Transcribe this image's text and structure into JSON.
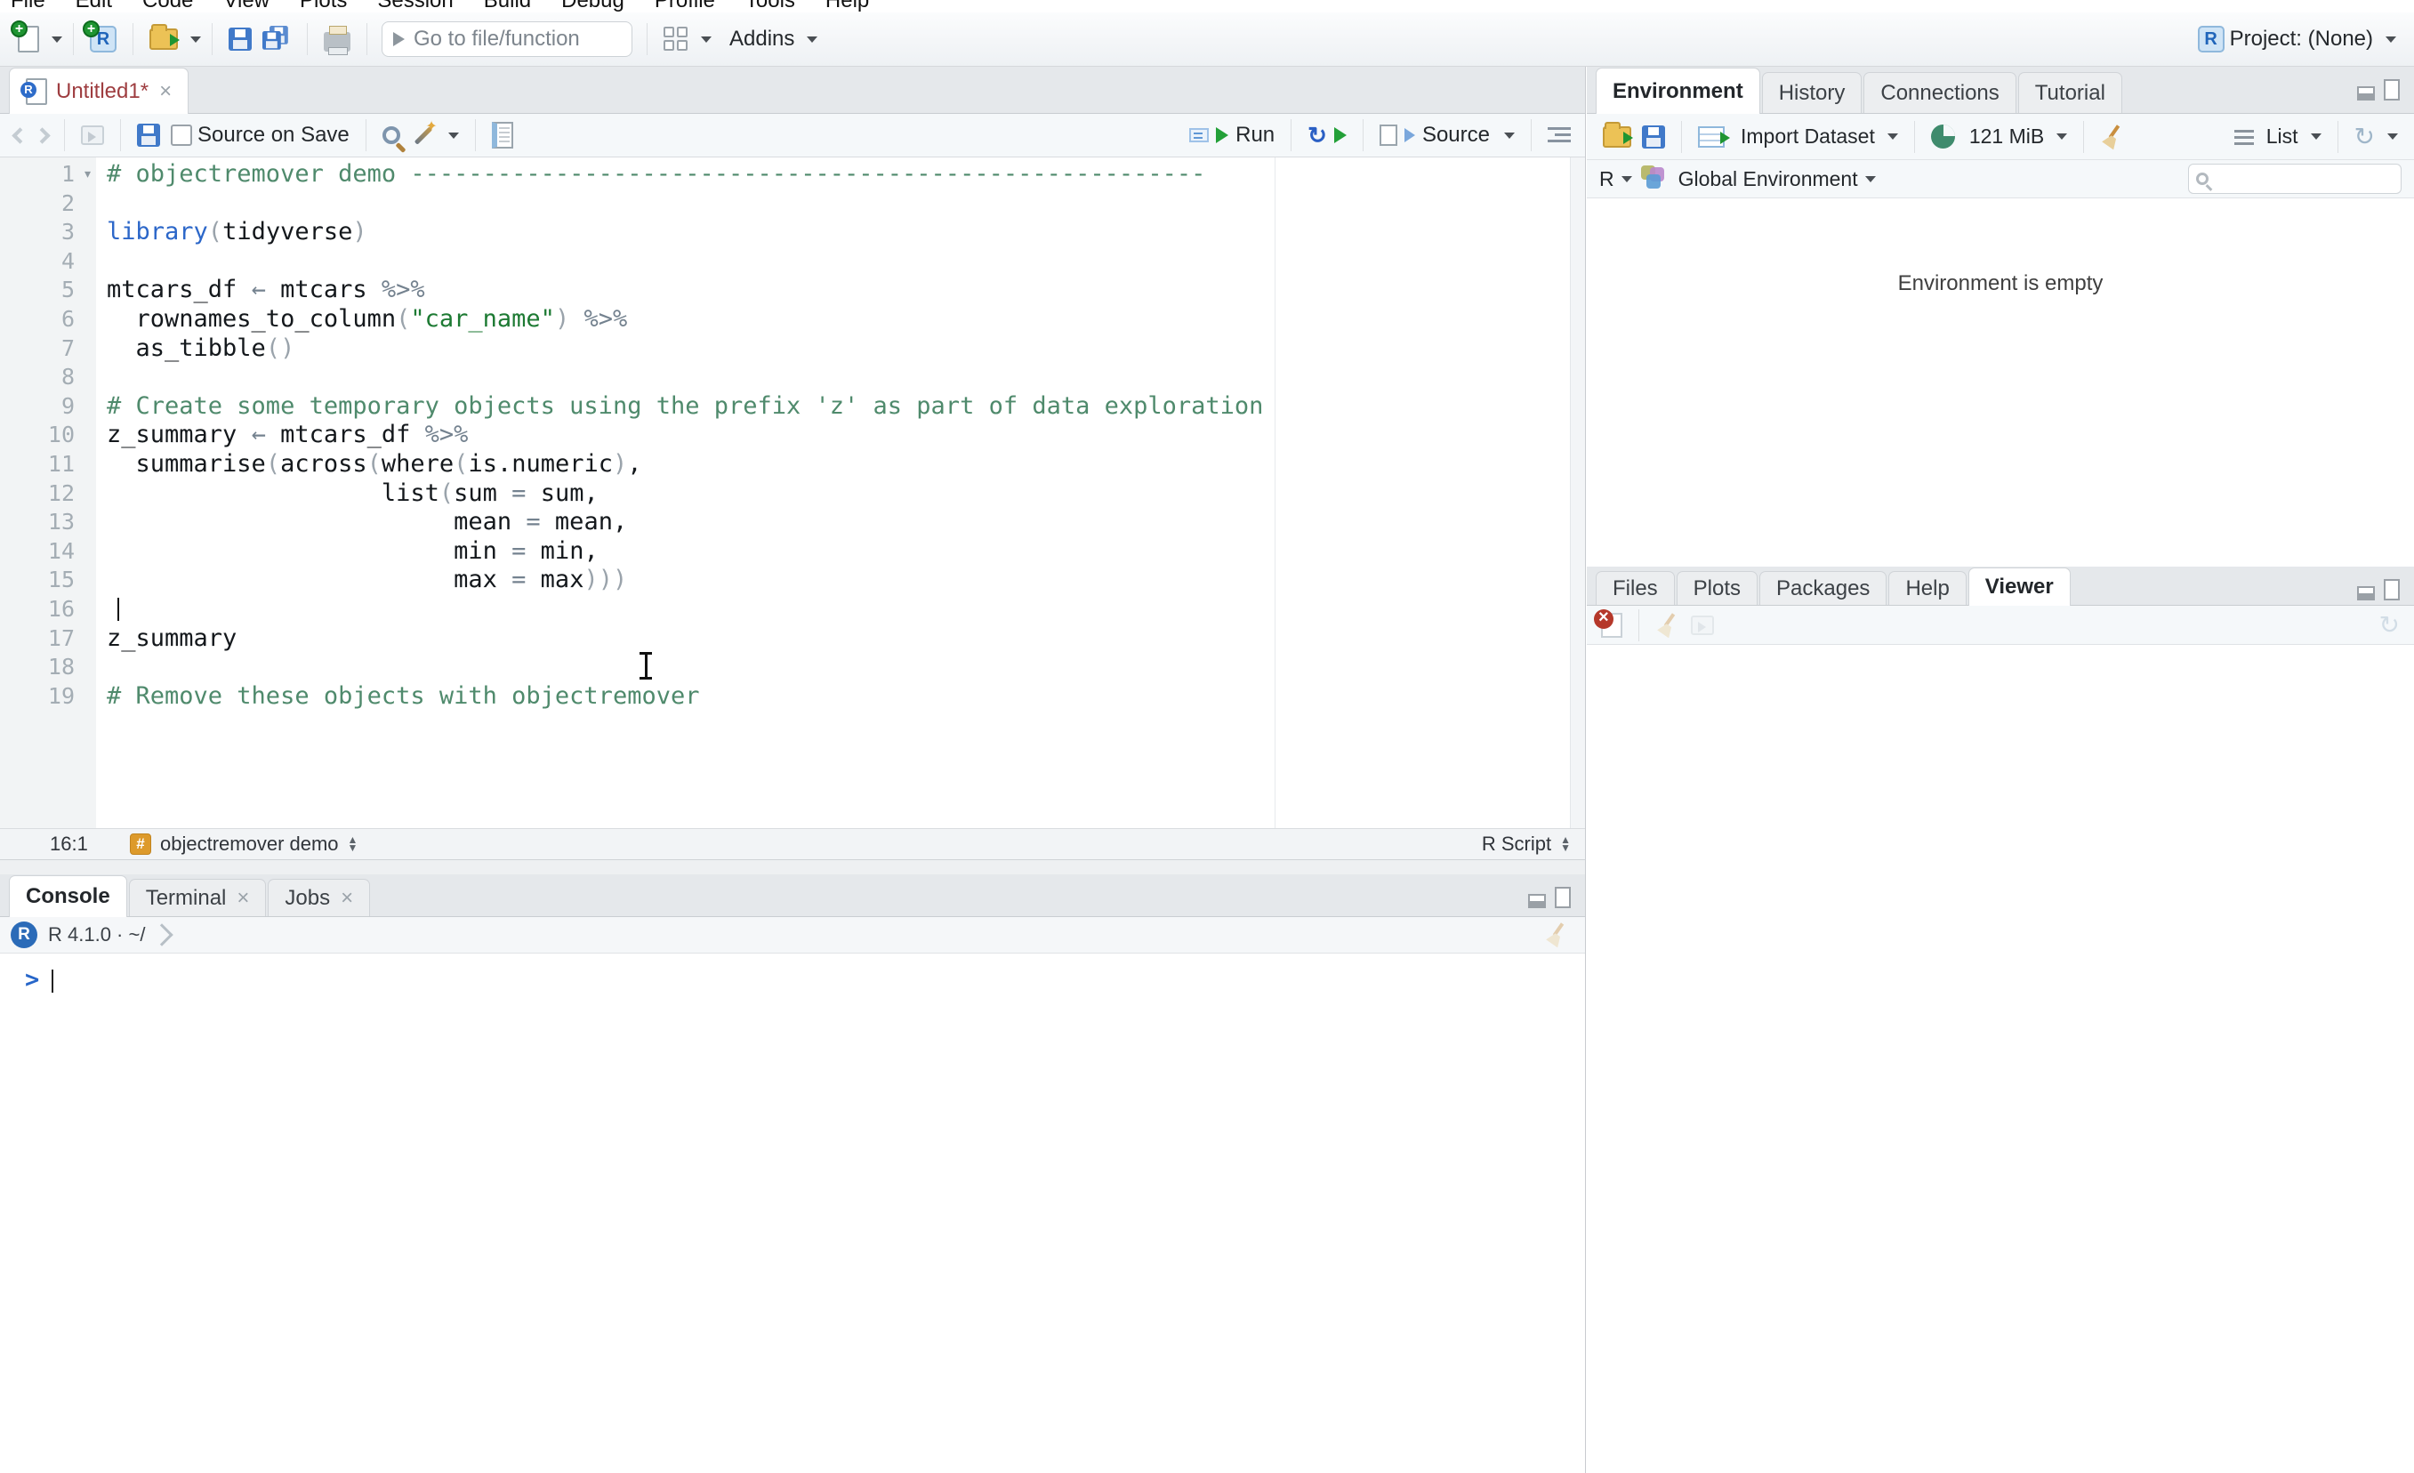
{
  "menu": {
    "items": [
      "File",
      "Edit",
      "Code",
      "View",
      "Plots",
      "Session",
      "Build",
      "Debug",
      "Profile",
      "Tools",
      "Help"
    ]
  },
  "toolbar": {
    "goto_placeholder": "Go to file/function",
    "addins_label": "Addins",
    "project_label": "Project: (None)"
  },
  "editor": {
    "tab_label": "Untitled1*",
    "source_on_save_label": "Source on Save",
    "run_label": "Run",
    "source_label": "Source",
    "status": {
      "position": "16:1",
      "section": "objectremover demo",
      "file_type": "R Script"
    },
    "lines": [
      {
        "n": 1,
        "fold": true,
        "seg": [
          {
            "c": "cm",
            "t": "# objectremover demo -------------------------------------------------------"
          }
        ]
      },
      {
        "n": 2,
        "seg": []
      },
      {
        "n": 3,
        "seg": [
          {
            "c": "kw",
            "t": "library"
          },
          {
            "c": "pn",
            "t": "("
          },
          {
            "c": "tx",
            "t": "tidyverse"
          },
          {
            "c": "pn",
            "t": ")"
          }
        ]
      },
      {
        "n": 4,
        "seg": []
      },
      {
        "n": 5,
        "seg": [
          {
            "c": "tx",
            "t": "mtcars_df "
          },
          {
            "c": "op",
            "t": "← "
          },
          {
            "c": "tx",
            "t": "mtcars "
          },
          {
            "c": "op",
            "t": "%>%"
          }
        ]
      },
      {
        "n": 6,
        "seg": [
          {
            "c": "tx",
            "t": "  rownames_to_column"
          },
          {
            "c": "pn",
            "t": "("
          },
          {
            "c": "str",
            "t": "\"car_name\""
          },
          {
            "c": "pn",
            "t": ") "
          },
          {
            "c": "op",
            "t": "%>%"
          }
        ]
      },
      {
        "n": 7,
        "seg": [
          {
            "c": "tx",
            "t": "  as_tibble"
          },
          {
            "c": "pn",
            "t": "()"
          }
        ]
      },
      {
        "n": 8,
        "seg": []
      },
      {
        "n": 9,
        "seg": [
          {
            "c": "cm",
            "t": "# Create some temporary objects using the prefix 'z' as part of data exploration"
          }
        ]
      },
      {
        "n": 10,
        "seg": [
          {
            "c": "tx",
            "t": "z_summary "
          },
          {
            "c": "op",
            "t": "← "
          },
          {
            "c": "tx",
            "t": "mtcars_df "
          },
          {
            "c": "op",
            "t": "%>%"
          }
        ]
      },
      {
        "n": 11,
        "seg": [
          {
            "c": "tx",
            "t": "  summarise"
          },
          {
            "c": "pn",
            "t": "("
          },
          {
            "c": "tx",
            "t": "across"
          },
          {
            "c": "pn",
            "t": "("
          },
          {
            "c": "tx",
            "t": "where"
          },
          {
            "c": "pn",
            "t": "("
          },
          {
            "c": "tx",
            "t": "is.numeric"
          },
          {
            "c": "pn",
            "t": ")"
          },
          {
            "c": "tx",
            "t": ","
          }
        ]
      },
      {
        "n": 12,
        "seg": [
          {
            "c": "tx",
            "t": "                   list"
          },
          {
            "c": "pn",
            "t": "("
          },
          {
            "c": "tx",
            "t": "sum "
          },
          {
            "c": "op",
            "t": "="
          },
          {
            "c": "tx",
            "t": " sum,"
          }
        ]
      },
      {
        "n": 13,
        "seg": [
          {
            "c": "tx",
            "t": "                        mean "
          },
          {
            "c": "op",
            "t": "="
          },
          {
            "c": "tx",
            "t": " mean,"
          }
        ]
      },
      {
        "n": 14,
        "seg": [
          {
            "c": "tx",
            "t": "                        min "
          },
          {
            "c": "op",
            "t": "="
          },
          {
            "c": "tx",
            "t": " min,"
          }
        ]
      },
      {
        "n": 15,
        "seg": [
          {
            "c": "tx",
            "t": "                        max "
          },
          {
            "c": "op",
            "t": "="
          },
          {
            "c": "tx",
            "t": " max"
          },
          {
            "c": "pn",
            "t": ")))"
          }
        ]
      },
      {
        "n": 16,
        "caret": true,
        "seg": []
      },
      {
        "n": 17,
        "seg": [
          {
            "c": "tx",
            "t": "z_summary"
          }
        ]
      },
      {
        "n": 18,
        "seg": []
      },
      {
        "n": 19,
        "seg": [
          {
            "c": "cm",
            "t": "# Remove these objects with objectremover"
          }
        ]
      }
    ]
  },
  "console": {
    "tabs": [
      "Console",
      "Terminal",
      "Jobs"
    ],
    "version_text": "R 4.1.0 · ~/",
    "prompt": ">"
  },
  "environment": {
    "tabs": [
      "Environment",
      "History",
      "Connections",
      "Tutorial"
    ],
    "toolbar": {
      "import_label": "Import Dataset",
      "memory_label": "121 MiB",
      "list_label": "List"
    },
    "scope": {
      "language": "R",
      "scope_label": "Global Environment"
    },
    "empty_text": "Environment is empty"
  },
  "viewer": {
    "tabs": [
      "Files",
      "Plots",
      "Packages",
      "Help",
      "Viewer"
    ]
  },
  "icons": {
    "close": "×",
    "rerun": "↻",
    "refresh": "↻",
    "up": "▲",
    "down": "▼",
    "fold": "▾"
  },
  "colors": {
    "accent_blue": "#2c67c9",
    "comment_green": "#4f8a6c",
    "string_green": "#1d7a33",
    "run_green": "#23a038",
    "modified_tab": "#9e3d40",
    "chunk_orange": "#dd9a2b"
  }
}
